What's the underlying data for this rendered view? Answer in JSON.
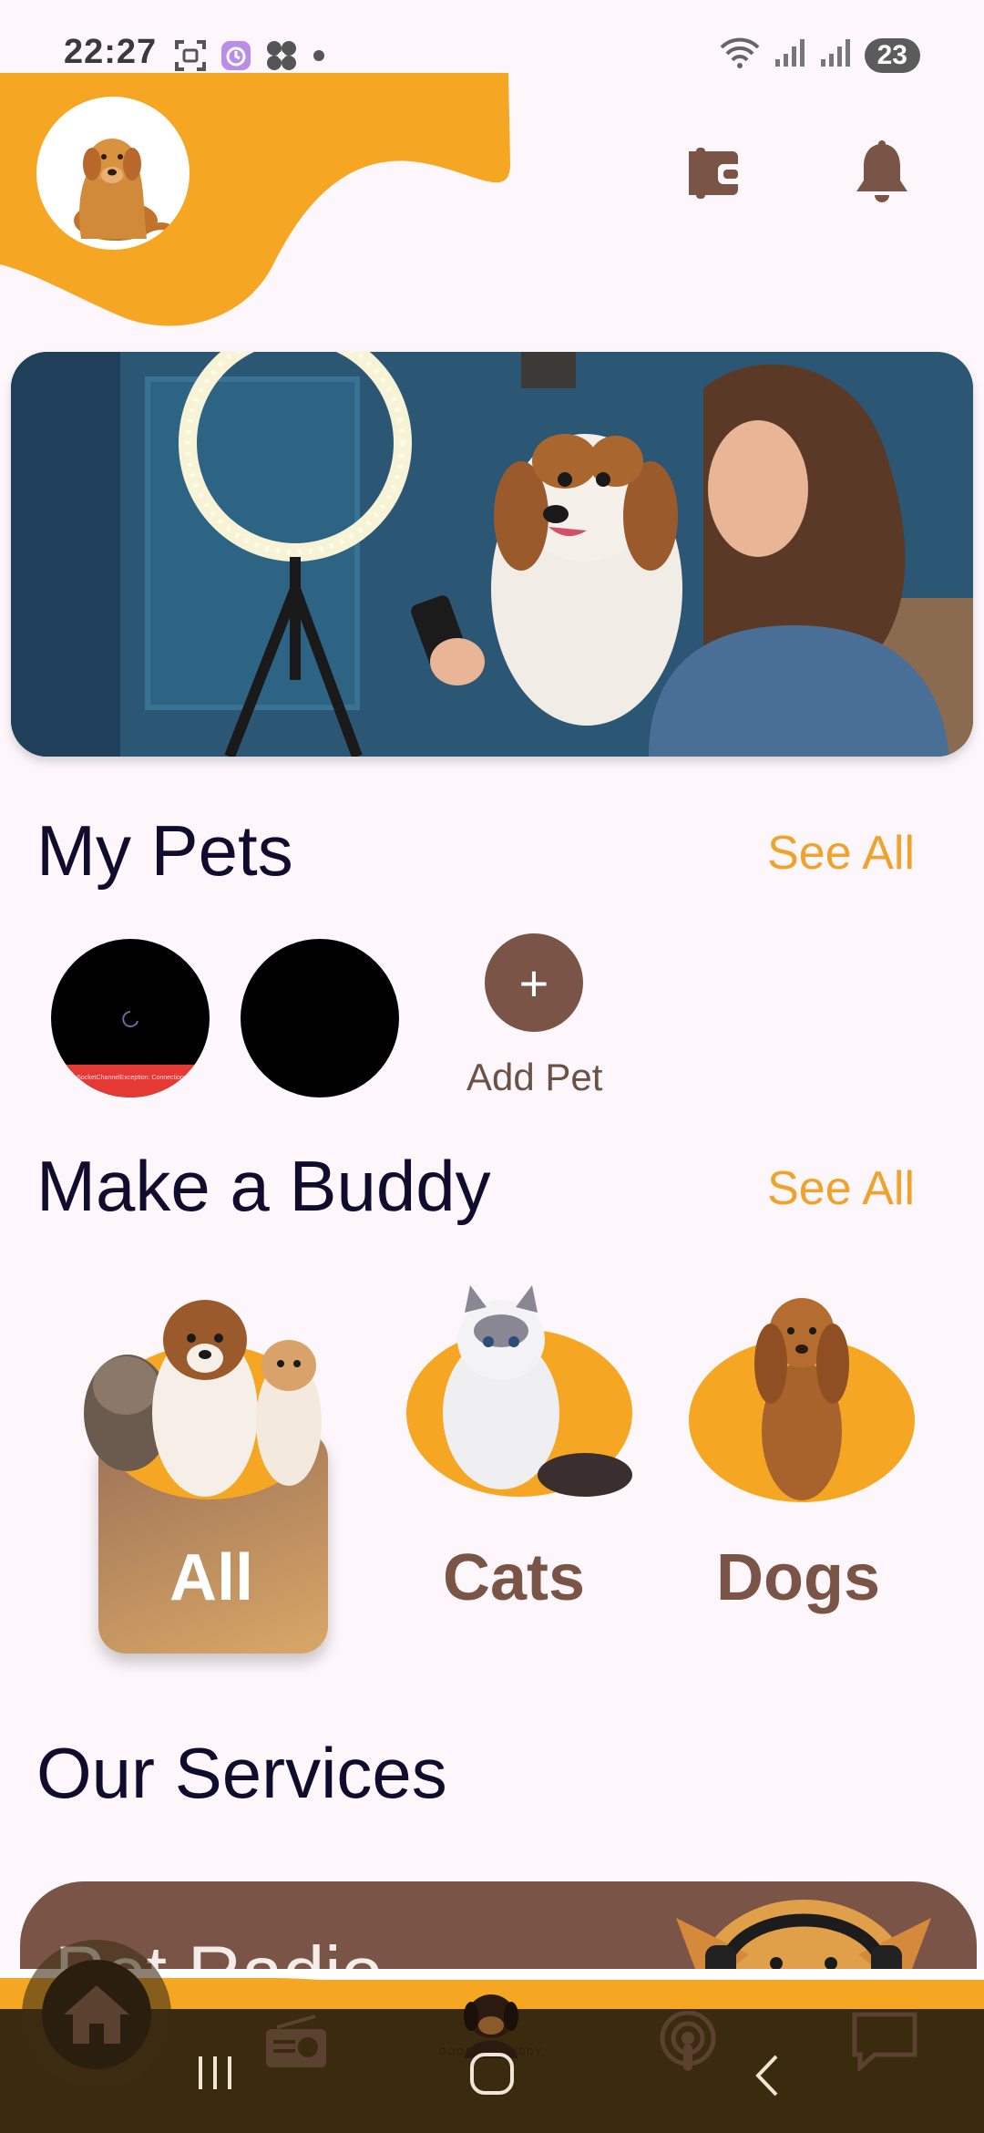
{
  "status_bar": {
    "time": "22:27",
    "battery": "23",
    "icons": [
      "screenshot-icon",
      "timer-icon",
      "fan-icon",
      "dot-icon",
      "wifi-icon",
      "signal-icon",
      "signal-icon"
    ]
  },
  "header": {
    "avatar": "golden-retriever-avatar",
    "wallet_icon": "wallet-icon",
    "bell_icon": "bell-icon"
  },
  "hero": {
    "image": "woman-with-dog-ring-light"
  },
  "my_pets": {
    "title": "My Pets",
    "see_all": "See All",
    "add_label": "Add Pet",
    "add_icon": "+",
    "error_text": "WebSocketChannelException: Connection to"
  },
  "buddy": {
    "title": "Make a Buddy",
    "see_all": "See All",
    "categories": [
      {
        "label": "All",
        "selected": true
      },
      {
        "label": "Cats",
        "selected": false
      },
      {
        "label": "Dogs",
        "selected": false
      }
    ]
  },
  "services": {
    "title": "Our Services",
    "card_title": "Pet Radio"
  },
  "nav": {
    "logo_text": "GOODBYE BUDDY"
  },
  "colors": {
    "accent": "#f5a623",
    "brown": "#7a5547",
    "title": "#0f0c2e",
    "background": "#fdf7fb"
  }
}
